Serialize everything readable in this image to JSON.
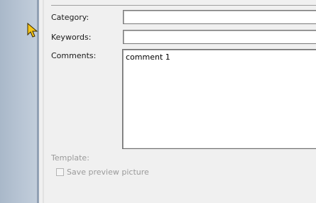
{
  "fields": {
    "category_label": "Category:",
    "category_value": "",
    "keywords_label": "Keywords:",
    "keywords_value": "",
    "comments_label": "Comments:",
    "comments_value": "comment 1"
  },
  "template": {
    "label": "Template:",
    "save_preview_label": "Save preview picture",
    "save_preview_checked": false
  },
  "colors": {
    "dialog_bg": "#f0f0f0",
    "disabled_text": "#9a9a9a",
    "cursor": "#f5c518"
  }
}
